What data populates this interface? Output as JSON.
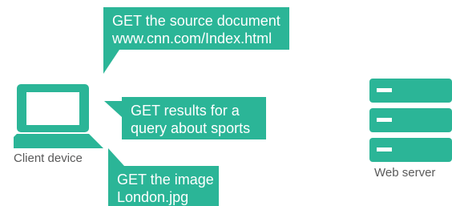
{
  "diagram": {
    "client": {
      "label": "Client device",
      "icon": "laptop-icon"
    },
    "server": {
      "label": "Web server",
      "icon": "server-icon"
    },
    "requests": [
      {
        "line1": "GET the source document",
        "line2": "www.cnn.com/Index.html"
      },
      {
        "line1": "GET results for a",
        "line2": "query about sports"
      },
      {
        "line1": "GET the image",
        "line2": "London.jpg"
      }
    ]
  },
  "colors": {
    "bubble": "#2bb597",
    "icon": "#2bb597",
    "caption": "#595959",
    "bubble_text": "#ffffff"
  }
}
